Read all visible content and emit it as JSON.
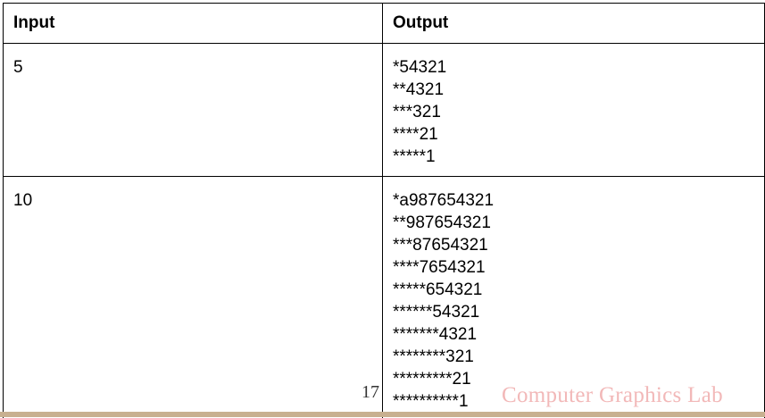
{
  "table": {
    "headers": [
      "Input",
      "Output"
    ],
    "rows": [
      {
        "input": "5",
        "output": [
          "*54321",
          "**4321",
          "***321",
          "****21",
          "*****1"
        ]
      },
      {
        "input": "10",
        "output": [
          "*a987654321",
          "**987654321",
          "***87654321",
          "****7654321",
          "*****654321",
          "******54321",
          "*******4321",
          "********321",
          "*********21",
          "**********1"
        ]
      }
    ]
  },
  "footer": {
    "page_number": "17",
    "watermark": "Computer Graphics Lab"
  },
  "colors": {
    "watermark": "#f2b8b8",
    "footer_bar": "#c8b090"
  }
}
